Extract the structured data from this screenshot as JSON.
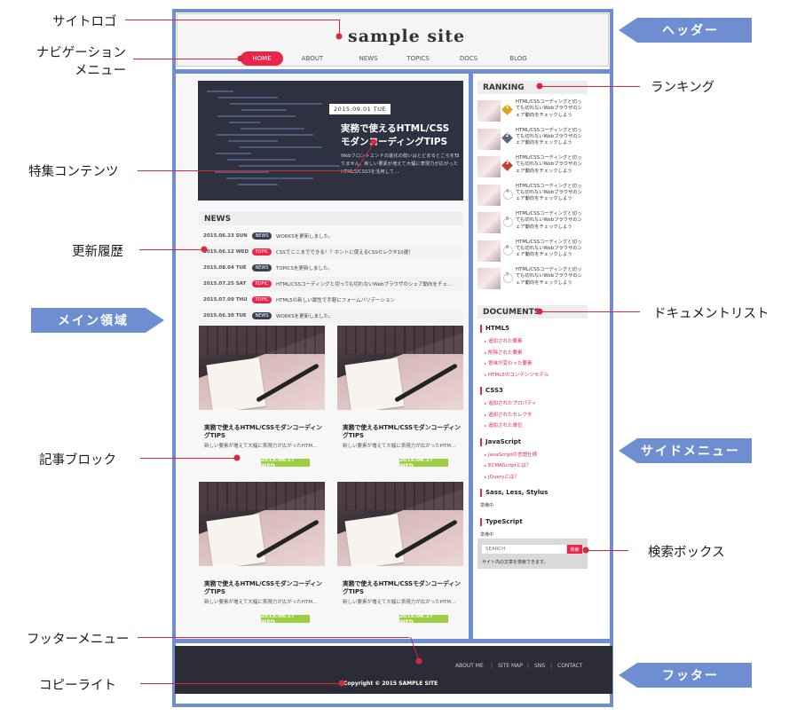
{
  "callouts": {
    "site_logo": "サイトロゴ",
    "navigation_line1": "ナビゲーション",
    "navigation_line2": "メニュー",
    "feature": "特集コンテンツ",
    "update_history": "更新履歴",
    "article_block": "記事ブロック",
    "footer_menu": "フッターメニュー",
    "copyright": "コピーライト",
    "ranking": "ランキング",
    "document_list": "ドキュメントリスト",
    "search_box": "検索ボックス"
  },
  "region_tags": {
    "header": "ヘッダー",
    "main": "メイン領域",
    "side": "サイドメニュー",
    "footer": "フッター"
  },
  "site": {
    "logo": "sample site",
    "nav": [
      "HOME",
      "ABOUT",
      "NEWS",
      "TOPICS",
      "DOCS",
      "BLOG"
    ],
    "feature": {
      "date": "2015.09.01 TUE",
      "title": "実務で使えるHTML/CSS モダンコーディングTIPS",
      "desc": "Webフロントエンドの進化の勢いはとどまるところを知りません。新しい要素が増えて大幅に表現力が広がったHTML5/CSS3を活用して…"
    },
    "news": {
      "heading": "NEWS",
      "rows": [
        {
          "date": "2015.06.23 SUN",
          "badge": "NEWS",
          "text": "WORKSを更新しました。"
        },
        {
          "date": "2015.06.12 WED",
          "badge": "TOPIC",
          "text": "CSSでここまでできる！？ホントに使えるCSSセレクタ10選！"
        },
        {
          "date": "2015.08.04 TUE",
          "badge": "NEWS",
          "text": "TOPICSを更新しました。"
        },
        {
          "date": "2015.07.25 SAT",
          "badge": "TOPIC",
          "text": "HTML/CSSコーディングと切っても切れないWebブラウザのシェア動向をチェ…"
        },
        {
          "date": "2015.07.09 THU",
          "badge": "TOPIC",
          "text": "HTML5の新しい属性で手軽にフォームバリデーション"
        },
        {
          "date": "2015.06.30 TUE",
          "badge": "NEWS",
          "text": "WORKSを更新しました。"
        }
      ],
      "badge_colors": {
        "NEWS": "#3a3f52",
        "TOPIC": "#e8264b"
      }
    },
    "articles": [
      {
        "title": "実務で使えるHTML/CSSモダンコーディングTIPS",
        "desc": "新しい要素が増えて大幅に表現力が広がったHTM…",
        "date": "2015.06.17 WED"
      },
      {
        "title": "実務で使えるHTML/CSSモダンコーディングTIPS",
        "desc": "新しい要素が増えて大幅に表現力が広がったHTM…",
        "date": "2015.06.17 WED"
      },
      {
        "title": "実務で使えるHTML/CSSモダンコーディングTIPS",
        "desc": "新しい要素が増えて大幅に表現力が広がったHTM…",
        "date": "2015.06.17 WED"
      },
      {
        "title": "実務で使えるHTML/CSSモダンコーディングTIPS",
        "desc": "新しい要素が増えて大幅に表現力が広がったHTM…",
        "date": "2015.06.17 WED"
      }
    ],
    "ranking": {
      "heading": "RANKING",
      "item_text": "HTML/CSSコーディングと切っても切れないWebブラウザのシェア動向をチェックしよう",
      "numbers": [
        "1",
        "2",
        "3",
        "4",
        "5",
        "6",
        "7"
      ],
      "colors": [
        "#e0a21b",
        "#5a6a78",
        "#c2452a",
        "#d0d0d0",
        "#d0d0d0",
        "#d0d0d0",
        "#d0d0d0"
      ]
    },
    "documents": {
      "heading": "DOCUMENTS",
      "cats": [
        {
          "name": "HTML5",
          "links": [
            "追加された要素",
            "削除された要素",
            "意味が変わった要素",
            "HTML5のコンテンツモデル"
          ]
        },
        {
          "name": "CSS3",
          "links": [
            "追加されたプロパティ",
            "追加されたセレクタ",
            "追加された単位"
          ]
        },
        {
          "name": "JavaScript",
          "links": [
            "JavaScriptの言語仕様",
            "ECMAScriptとは？",
            "jQueryとは？"
          ]
        },
        {
          "name": "Sass, Less, Stylus",
          "links": [],
          "note": "準備中"
        },
        {
          "name": "TypeScript",
          "links": [],
          "note": "準備中"
        }
      ]
    },
    "search": {
      "placeholder": "SEARCH",
      "button": "検索",
      "note": "サイト内の文章を検索できます。"
    },
    "footer": {
      "menu": [
        "ABOUT ME",
        "SITE MAP",
        "SNS",
        "CONTACT"
      ],
      "separator": "|",
      "copyright": "Copyright © 2015 SAMPLE SITE"
    }
  },
  "colors": {
    "accent_red": "#e8264b",
    "frame_blue": "#6e8ed1",
    "footer_dark": "#2c2c37",
    "date_green": "#9acd42",
    "callout_red": "#d8283e"
  }
}
